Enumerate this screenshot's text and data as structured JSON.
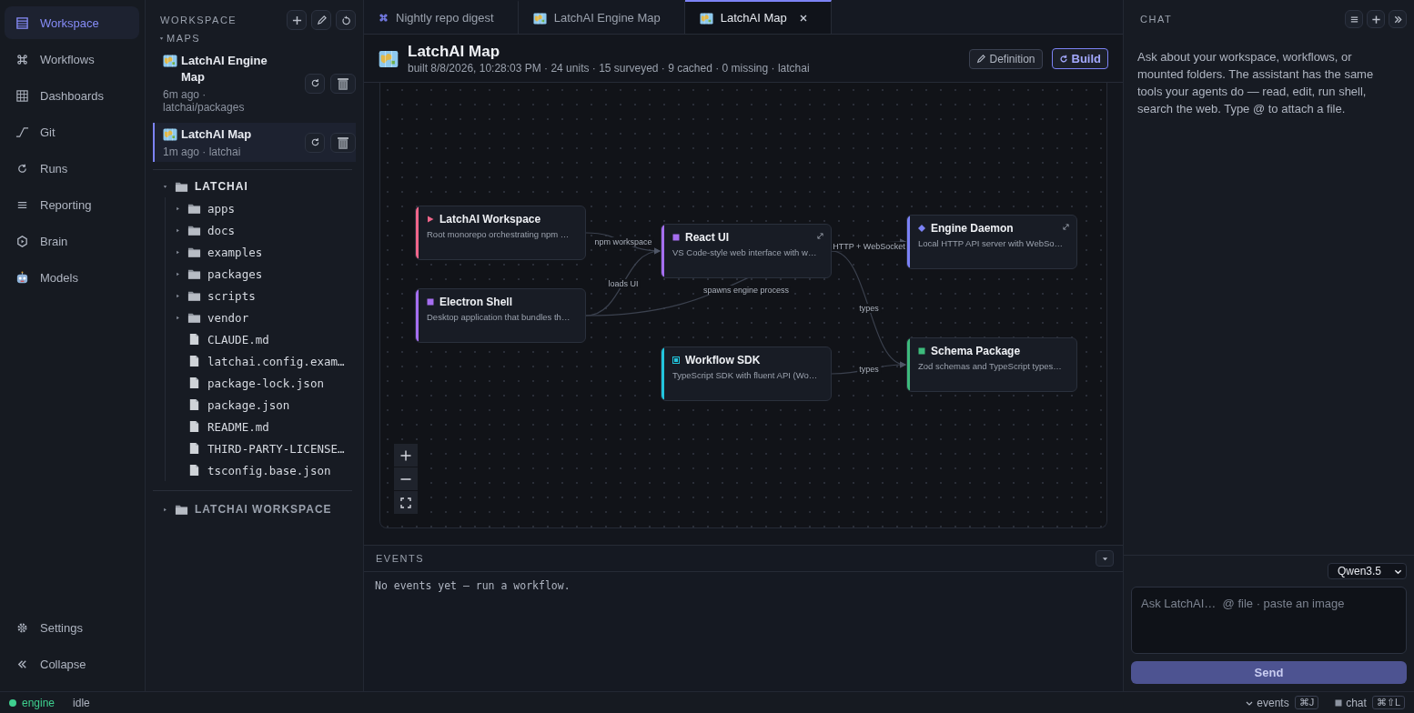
{
  "nav": {
    "items": [
      {
        "label": "Workspace",
        "selected": true
      },
      {
        "label": "Workflows",
        "selected": false
      },
      {
        "label": "Dashboards",
        "selected": false
      },
      {
        "label": "Git",
        "selected": false
      },
      {
        "label": "Runs",
        "selected": false
      },
      {
        "label": "Reporting",
        "selected": false
      },
      {
        "label": "Brain",
        "selected": false
      },
      {
        "label": "Models",
        "selected": false
      }
    ],
    "footer": [
      {
        "label": "Settings"
      },
      {
        "label": "Collapse"
      }
    ]
  },
  "explorer": {
    "title": "WORKSPACE",
    "maps": {
      "label": "MAPS",
      "expanded": true,
      "items": [
        {
          "title": "LatchAI Engine Map",
          "meta": "6m ago · latchai/packages",
          "selected": false
        },
        {
          "title": "LatchAI Map",
          "meta": "1m ago · latchai",
          "selected": true
        }
      ]
    },
    "roots": [
      {
        "name": "LATCHAI",
        "expanded": true,
        "children": [
          {
            "name": "apps",
            "kind": "folder",
            "expanded": false
          },
          {
            "name": "docs",
            "kind": "folder",
            "expanded": false
          },
          {
            "name": "examples",
            "kind": "folder",
            "expanded": false
          },
          {
            "name": "packages",
            "kind": "folder",
            "expanded": false
          },
          {
            "name": "scripts",
            "kind": "folder",
            "expanded": false
          },
          {
            "name": "vendor",
            "kind": "folder",
            "expanded": false
          },
          {
            "name": "CLAUDE.md",
            "kind": "file"
          },
          {
            "name": "latchai.config.exam…",
            "kind": "file"
          },
          {
            "name": "package-lock.json",
            "kind": "file"
          },
          {
            "name": "package.json",
            "kind": "file"
          },
          {
            "name": "README.md",
            "kind": "file"
          },
          {
            "name": "THIRD-PARTY-LICENSE…",
            "kind": "file"
          },
          {
            "name": "tsconfig.base.json",
            "kind": "file"
          }
        ]
      },
      {
        "name": "LATCHAI WORKSPACE",
        "expanded": false
      }
    ]
  },
  "tabs": [
    {
      "label": "Nightly repo digest",
      "kind": "workflow",
      "selected": false
    },
    {
      "label": "LatchAI Engine Map",
      "kind": "map",
      "selected": false
    },
    {
      "label": "LatchAI Map",
      "kind": "map",
      "selected": true
    }
  ],
  "header": {
    "title": "LatchAI Map",
    "meta": "built 8/8/2026, 10:28:03 PM · 24 units · 15 surveyed · 9 cached · 0 missing · latchai",
    "actions": [
      {
        "label": "Definition",
        "primary": false
      },
      {
        "label": "Build",
        "primary": true
      }
    ]
  },
  "graph": {
    "nodes": [
      {
        "title": "LatchAI Workspace",
        "description": "Root monorepo orchestrating npm …",
        "color": "#f0668a",
        "kind": "triangle",
        "expandable": false
      },
      {
        "title": "React UI",
        "description": "VS Code-style web interface with w…",
        "color": "#a56ef0",
        "kind": "square",
        "expandable": true
      },
      {
        "title": "Engine Daemon",
        "description": "Local HTTP API server with WebSo…",
        "color": "#7b82f6",
        "kind": "diamond",
        "expandable": true
      },
      {
        "title": "Electron Shell",
        "description": "Desktop application that bundles th…",
        "color": "#a56ef0",
        "kind": "square",
        "expandable": false
      },
      {
        "title": "Workflow SDK",
        "description": "TypeScript SDK with fluent API (Wo…",
        "color": "#22c5dd",
        "kind": "framed",
        "expandable": false
      },
      {
        "title": "Schema Package",
        "description": "Zod schemas and TypeScript types…",
        "color": "#3dbb7c",
        "kind": "square",
        "expandable": false
      }
    ],
    "edges": [
      {
        "label": "npm workspace"
      },
      {
        "label": "loads UI"
      },
      {
        "label": "spawns engine process"
      },
      {
        "label": "HTTP + WebSocket"
      },
      {
        "label": "types"
      },
      {
        "label": "types"
      }
    ]
  },
  "events": {
    "title": "EVENTS",
    "expanded": true,
    "empty_text": "No events yet — run a workflow."
  },
  "chat": {
    "title": "CHAT",
    "intro": "Ask about your workspace, workflows, or mounted folders. The assistant has the same tools your agents do — read, edit, run shell, search the web. Type @ to attach a file.",
    "model": "Qwen3.5",
    "placeholder": "Ask LatchAI…  @ file · paste an image",
    "send": "Send"
  },
  "status_bar": {
    "engine": {
      "label": "engine",
      "color": "#3ecf8e"
    },
    "state": "idle",
    "shortcuts": [
      {
        "label": "events",
        "key": "⌘J"
      },
      {
        "label": "chat",
        "key": "⌘⇧L"
      }
    ]
  }
}
